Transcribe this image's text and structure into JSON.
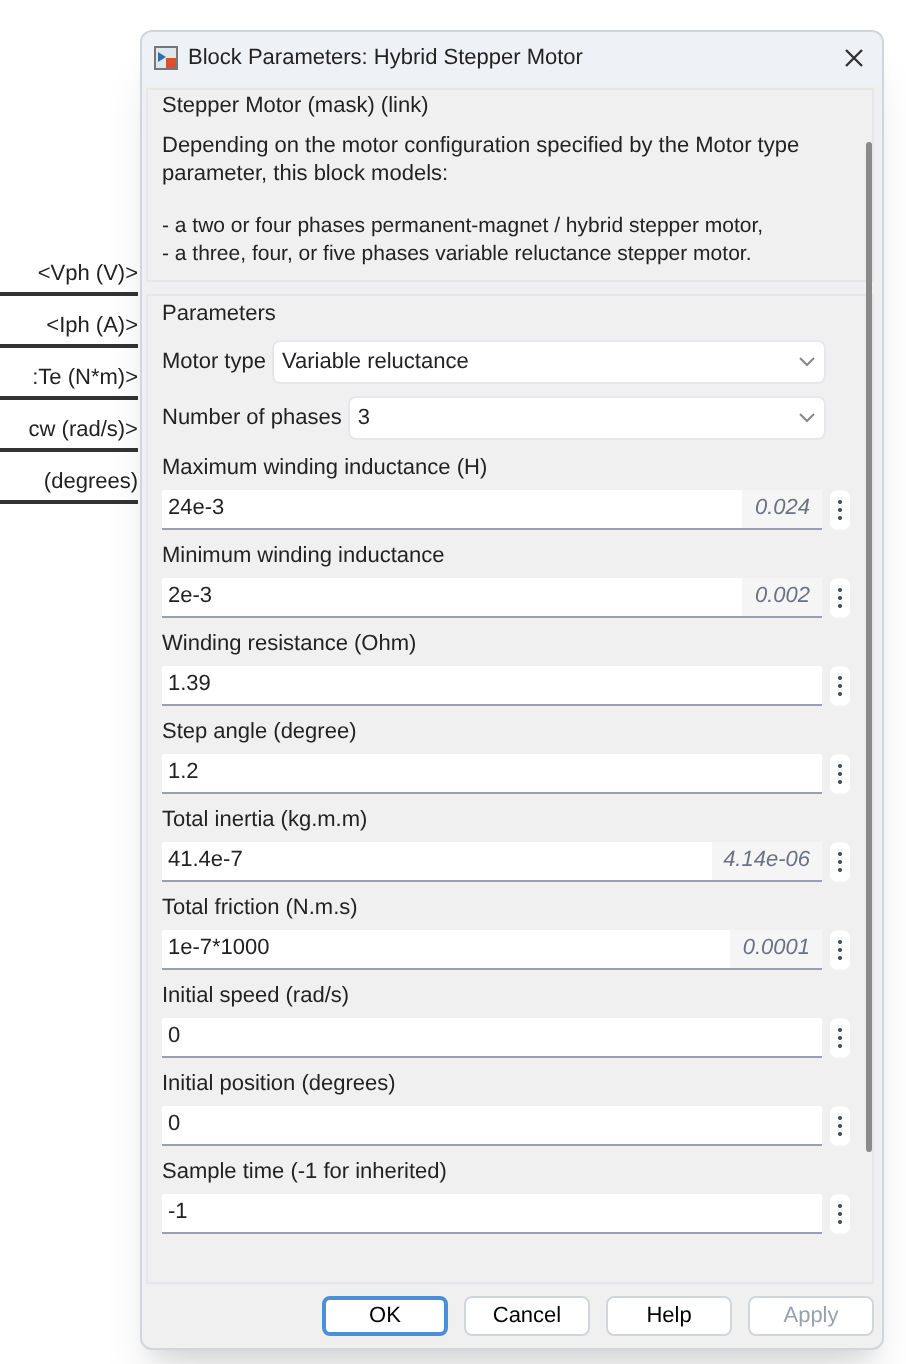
{
  "canvas_labels": [
    "<Vph (V)>",
    "<Iph (A)>",
    ":Te (N*m)>",
    "cw (rad/s)>",
    "(degrees)"
  ],
  "window": {
    "title": "Block Parameters: Hybrid Stepper Motor"
  },
  "description": {
    "title": "Stepper Motor (mask) (link)",
    "text": "Depending on the motor configuration specified by the Motor type parameter,  this block models:",
    "bullets": [
      "- a two or four phases permanent-magnet / hybrid stepper motor,",
      "- a three, four, or five phases variable reluctance stepper motor."
    ]
  },
  "parameters": {
    "title": "Parameters",
    "items": [
      {
        "kind": "dropdown",
        "label": "Motor type",
        "value": "Variable reluctance"
      },
      {
        "kind": "dropdown",
        "label": "Number of phases",
        "value": "3"
      },
      {
        "kind": "edit",
        "label": "Maximum winding inductance (H)",
        "value": "24e-3",
        "evaluated": "0.024"
      },
      {
        "kind": "edit",
        "label": "Minimum winding inductance",
        "value": "2e-3",
        "evaluated": "0.002"
      },
      {
        "kind": "edit",
        "label": "Winding resistance (Ohm)",
        "value": "1.39"
      },
      {
        "kind": "edit",
        "label": "Step angle (degree)",
        "value": "1.2"
      },
      {
        "kind": "edit",
        "label": "Total inertia (kg.m.m)",
        "value": "41.4e-7",
        "evaluated": "4.14e-06"
      },
      {
        "kind": "edit",
        "label": "Total friction (N.m.s)",
        "value": "1e-7*1000",
        "evaluated": "0.0001"
      },
      {
        "kind": "edit",
        "label": "Initial speed (rad/s)",
        "value": "0"
      },
      {
        "kind": "edit",
        "label": "Initial position (degrees)",
        "value": "0"
      },
      {
        "kind": "edit",
        "label": "Sample time (-1 for inherited)",
        "value": "-1"
      }
    ]
  },
  "buttons": [
    {
      "label": "OK",
      "focused": true,
      "disabled": false
    },
    {
      "label": "Cancel",
      "focused": false,
      "disabled": false
    },
    {
      "label": "Help",
      "focused": false,
      "disabled": false
    },
    {
      "label": "Apply",
      "focused": false,
      "disabled": true
    }
  ]
}
